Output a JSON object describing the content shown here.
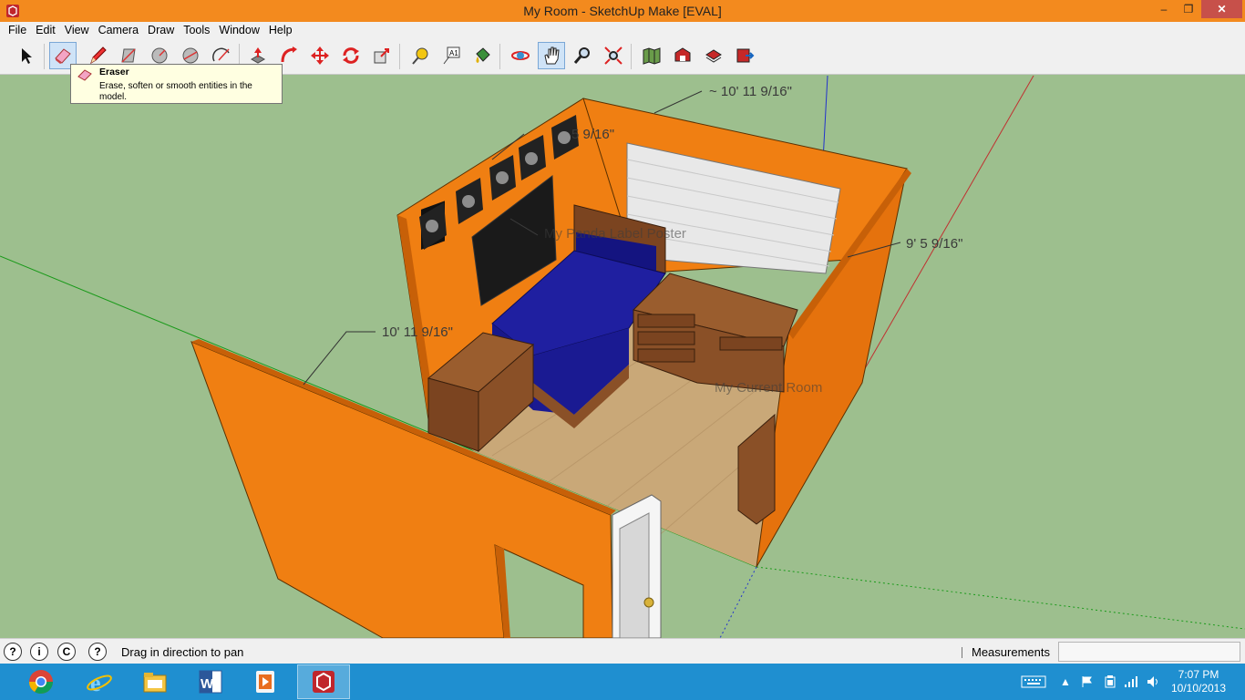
{
  "window": {
    "title": "My Room - SketchUp Make [EVAL]",
    "minimize_glyph": "–",
    "maximize_glyph": "❐",
    "close_glyph": "✕"
  },
  "menu": [
    "File",
    "Edit",
    "View",
    "Camera",
    "Draw",
    "Tools",
    "Window",
    "Help"
  ],
  "toolbar": {
    "tools": [
      {
        "name": "select-tool",
        "icon": "arrow-icon"
      },
      {
        "name": "eraser-tool",
        "icon": "eraser-icon",
        "active": true
      },
      {
        "name": "line-tool",
        "icon": "pencil-icon"
      },
      {
        "name": "rectangle-tool",
        "icon": "rectangle-icon"
      },
      {
        "name": "circle-tool",
        "icon": "circle-icon"
      },
      {
        "name": "polygon-tool",
        "icon": "polygon-icon"
      },
      {
        "name": "arc-tool",
        "icon": "arc-icon"
      },
      {
        "name": "push-pull-tool",
        "icon": "push-pull-icon"
      },
      {
        "name": "follow-me-tool",
        "icon": "follow-me-icon"
      },
      {
        "name": "move-tool",
        "icon": "move-icon"
      },
      {
        "name": "rotate-tool",
        "icon": "rotate-icon"
      },
      {
        "name": "scale-tool",
        "icon": "scale-icon"
      },
      {
        "name": "tape-measure-tool",
        "icon": "tape-measure-icon"
      },
      {
        "name": "text-tool",
        "icon": "text-icon"
      },
      {
        "name": "paint-bucket-tool",
        "icon": "paint-bucket-icon"
      },
      {
        "name": "orbit-tool",
        "icon": "orbit-icon"
      },
      {
        "name": "pan-tool",
        "icon": "hand-icon",
        "active": true
      },
      {
        "name": "zoom-tool",
        "icon": "magnifier-icon"
      },
      {
        "name": "zoom-extents-tool",
        "icon": "zoom-extents-icon"
      },
      {
        "name": "add-location-tool",
        "icon": "map-icon"
      },
      {
        "name": "3d-warehouse-tool",
        "icon": "warehouse-icon"
      },
      {
        "name": "share-model-tool",
        "icon": "share-model-icon"
      },
      {
        "name": "extension-warehouse-tool",
        "icon": "extension-icon"
      }
    ]
  },
  "tooltip": {
    "title": "Eraser",
    "body": "Erase, soften or smooth entities in the model."
  },
  "viewport": {
    "dimensions": {
      "top_wall": "~ 10' 11 9/16\"",
      "left_top": "5 9/16\"",
      "right_wall": "9' 5 9/16\"",
      "front_wall": "10' 11 9/16\""
    },
    "labels": {
      "poster": "My Panda Label Poster",
      "room": "My Current Room"
    },
    "colors": {
      "background": "#9dbf8e",
      "wall": "#f07f12",
      "bed": "#1f1fa0",
      "wood": "#8a5027"
    }
  },
  "statusbar": {
    "message": "Drag in direction to pan",
    "measurements_label": "Measurements",
    "measurements_value": "",
    "icons": [
      "geo-location-icon",
      "credits-icon",
      "copyright-icon",
      "help-icon"
    ]
  },
  "taskbar": {
    "apps": [
      "chrome-icon",
      "internet-explorer-icon",
      "file-explorer-icon",
      "word-icon",
      "media-player-icon",
      "sketchup-icon"
    ],
    "clock_time": "7:07 PM",
    "clock_date": "10/10/2013"
  }
}
